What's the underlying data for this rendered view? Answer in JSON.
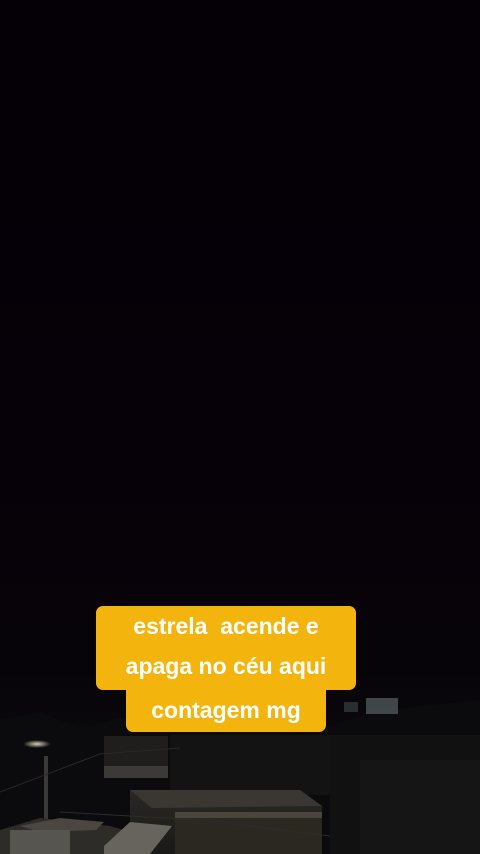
{
  "caption": {
    "lines": [
      "estrela  acende e",
      "apaga no céu aqui",
      "contagem mg"
    ],
    "background_color": "#f4b40e",
    "text_color": "#ffffff"
  },
  "scene": {
    "description_colors": {
      "sky": "#050006",
      "rooftops": "#1a1918"
    }
  }
}
